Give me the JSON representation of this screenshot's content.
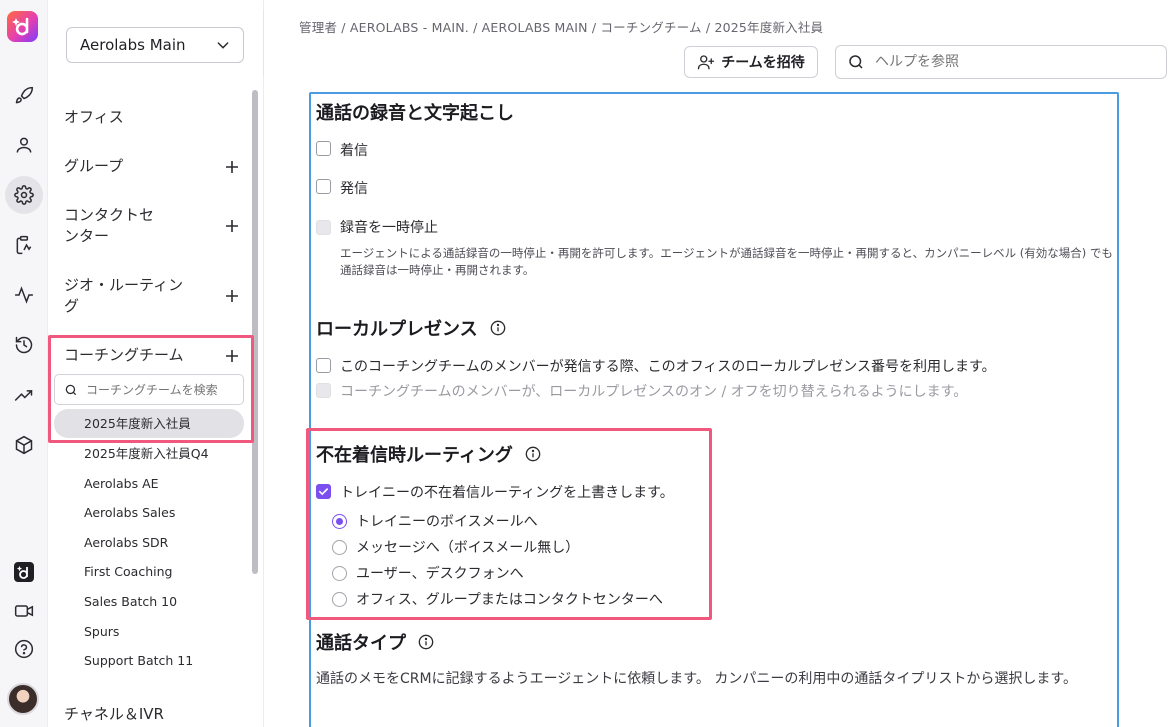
{
  "nav": {
    "office_select": "Aerolabs Main",
    "items": [
      {
        "label": "オフィス"
      },
      {
        "label": "グループ"
      },
      {
        "label": "コンタクトセンター"
      },
      {
        "label": "ジオ・ルーティング"
      },
      {
        "label": "コーチングチーム"
      },
      {
        "label": "チャネル＆IVR"
      }
    ],
    "coaching_search_placeholder": "コーチングチームを検索",
    "teams": [
      "2025年度新入社員",
      "2025年度新入社員Q4",
      "Aerolabs AE",
      "Aerolabs Sales",
      "Aerolabs SDR",
      "First Coaching",
      "Sales Batch 10",
      "Spurs",
      "Support Batch 11"
    ],
    "selected_team_index": 0
  },
  "header": {
    "breadcrumb": "管理者 / AEROLABS - MAIN. / AEROLABS MAIN / コーチングチーム / 2025年度新入社員",
    "invite_button": "チームを招待",
    "help_placeholder": "ヘルプを参照"
  },
  "recording": {
    "title": "通話の録音と文字起こし",
    "incoming": "着信",
    "outgoing": "発信",
    "pause": "録音を一時停止",
    "pause_help": "エージェントによる通話録音の一時停止・再開を許可します。エージェントが通話録音を一時停止・再開すると、カンパニーレベル (有効な場合) でも通話録音は一時停止・再開されます。"
  },
  "local_presence": {
    "title": "ローカルプレゼンス",
    "option1": "このコーチングチームのメンバーが発信する際、このオフィスのローカルプレゼンス番号を利用します。",
    "option2": "コーチングチームのメンバーが、ローカルプレゼンスのオン / オフを切り替えられるようにします。"
  },
  "missed_call_routing": {
    "title": "不在着信時ルーティング",
    "override": "トレイニーの不在着信ルーティングを上書きします。",
    "override_checked": true,
    "options": [
      "トレイニーのボイスメールへ",
      "メッセージへ（ボイスメール無し）",
      "ユーザー、デスクフォンへ",
      "オフィス、グループまたはコンタクトセンターへ"
    ],
    "selected_index": 0
  },
  "call_type": {
    "title": "通話タイプ",
    "description": "通話のメモをCRMに記録するようエージェントに依頼します。 カンパニーの利用中の通話タイプリストから選択します。"
  },
  "colors": {
    "accent": "#7b4ff0",
    "highlight": "#f0587d",
    "panel_border": "#4a9be0"
  }
}
